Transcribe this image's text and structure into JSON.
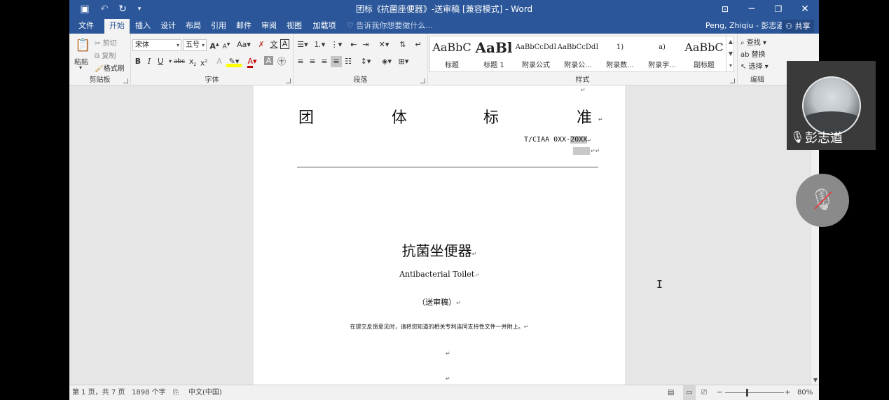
{
  "window": {
    "title": "团标《抗菌座便器》-送审稿 [兼容模式] - Word",
    "quick_access": [
      "save-icon",
      "undo-icon",
      "redo-icon",
      "customize-icon"
    ]
  },
  "tabs": [
    {
      "label": "文件"
    },
    {
      "label": "开始",
      "active": true
    },
    {
      "label": "插入"
    },
    {
      "label": "设计"
    },
    {
      "label": "布局"
    },
    {
      "label": "引用"
    },
    {
      "label": "邮件"
    },
    {
      "label": "审阅"
    },
    {
      "label": "视图"
    },
    {
      "label": "加载项"
    }
  ],
  "tell_me": "告诉我你想要做什么...",
  "user": "Peng, Zhiqiu - 彭志遒",
  "share_label": "共享",
  "ribbon": {
    "clipboard": {
      "group_label": "剪贴板",
      "paste": "粘贴",
      "cut": "剪切",
      "copy": "复制",
      "format_painter": "格式刷"
    },
    "font": {
      "group_label": "字体",
      "font_name": "宋体",
      "font_size": "五号"
    },
    "paragraph": {
      "group_label": "段落"
    },
    "styles": {
      "group_label": "样式",
      "items": [
        {
          "sample": "AaBbC",
          "name": "标题"
        },
        {
          "sample": "AaBl",
          "name": "标题 1"
        },
        {
          "sample": "AaBbCcDdI",
          "name": "附录公式"
        },
        {
          "sample": "AaBbCcDdI",
          "name": "附录公..."
        },
        {
          "sample": "1)",
          "name": "附录数..."
        },
        {
          "sample": "a)",
          "name": "附录字..."
        },
        {
          "sample": "AaBbC",
          "name": "副标题"
        }
      ]
    },
    "editing": {
      "group_label": "编辑",
      "find": "查找",
      "replace": "替换",
      "select": "选择"
    }
  },
  "document": {
    "header_chars": [
      "团",
      "体",
      "标",
      "准"
    ],
    "std_number": "T/CIAA 0XX-",
    "std_number_selected": "20XX",
    "title_cn": "抗菌坐便器",
    "title_en": "Antibacterial Toilet",
    "draft_label": "（送审稿）",
    "notice": "在提交反馈意见时，请将您知道的相关专利连同支持性文件一并附上。"
  },
  "status": {
    "page": "第 1 页，共 7 页",
    "words": "1898 个字",
    "language": "中文(中国)",
    "zoom": "80%"
  },
  "meeting": {
    "participant_name": "彭志遒"
  }
}
